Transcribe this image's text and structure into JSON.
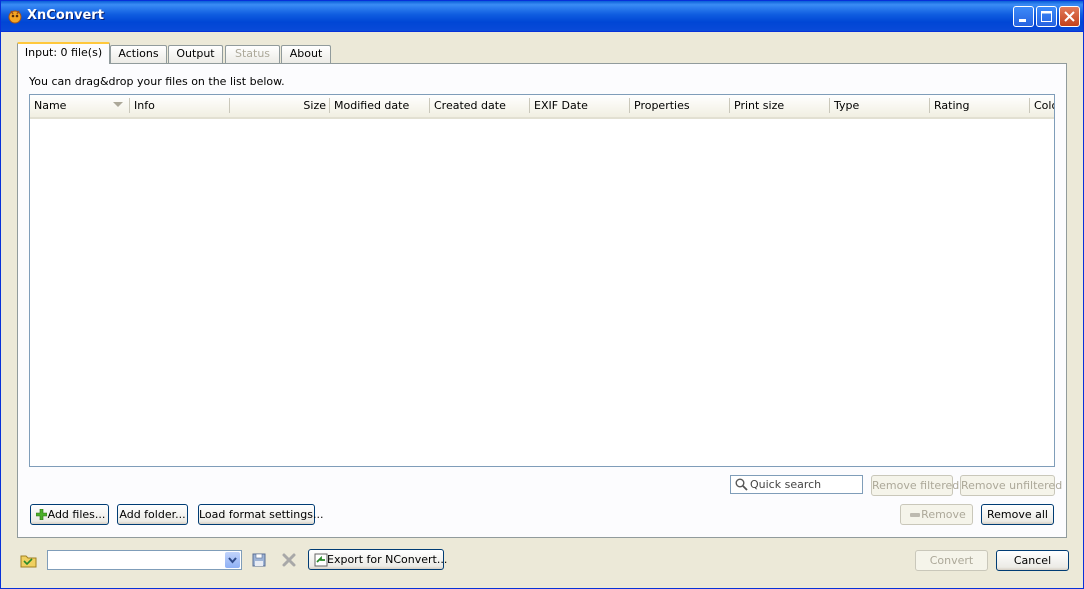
{
  "window": {
    "title": "XnConvert"
  },
  "tabs": [
    {
      "label": "Input: 0 file(s)",
      "active": true,
      "enabled": true
    },
    {
      "label": "Actions",
      "active": false,
      "enabled": true
    },
    {
      "label": "Output",
      "active": false,
      "enabled": true
    },
    {
      "label": "Status",
      "active": false,
      "enabled": false
    },
    {
      "label": "About",
      "active": false,
      "enabled": true
    }
  ],
  "input": {
    "hint": "You can drag&drop your files on the list below.",
    "columns": [
      "Name",
      "Info",
      "Size",
      "Modified date",
      "Created date",
      "EXIF Date",
      "Properties",
      "Print size",
      "Type",
      "Rating",
      "Color"
    ],
    "rows": [],
    "search_placeholder": "Quick search",
    "remove_filtered": "Remove filtered",
    "remove_unfiltered": "Remove unfiltered",
    "add_files": "Add files...",
    "add_folder": "Add folder...",
    "load_format_settings": "Load format settings...",
    "remove": "Remove",
    "remove_all": "Remove all"
  },
  "footer": {
    "preset_value": "",
    "export_nconvert": "Export for NConvert...",
    "convert": "Convert",
    "cancel": "Cancel"
  },
  "colors": {
    "title_bar": "#0054e3",
    "tab_highlight": "#ffc83c",
    "button_border": "#003c74",
    "disabled_text": "#aca899"
  }
}
